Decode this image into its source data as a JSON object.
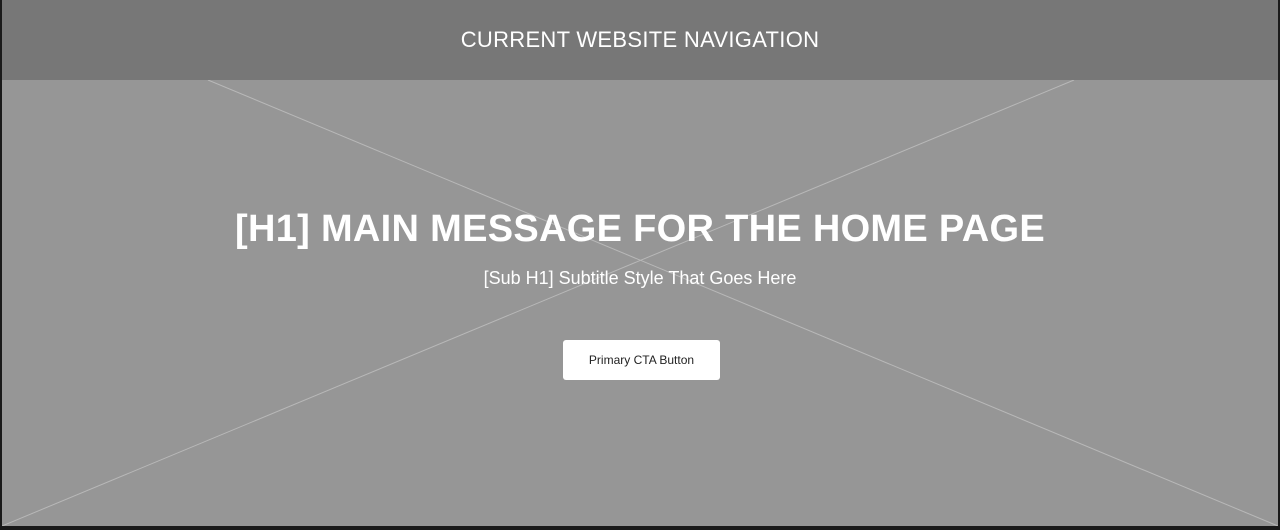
{
  "nav": {
    "title": "CURRENT WEBSITE NAVIGATION"
  },
  "hero": {
    "headline": "[H1] MAIN MESSAGE FOR THE HOME PAGE",
    "subtitle": "[Sub H1] Subtitle Style That Goes Here",
    "cta_label": "Primary CTA Button",
    "placeholder_icon": "image-placeholder-cross"
  },
  "colors": {
    "nav_background": "#777777",
    "hero_background": "#969696",
    "button_background": "#ffffff",
    "text_light": "#ffffff"
  }
}
